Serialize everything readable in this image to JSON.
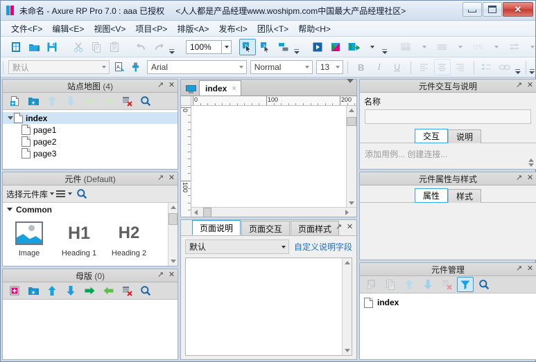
{
  "window": {
    "title": "未命名 - Axure RP Pro 7.0 : aaa 已授权",
    "subtitle": "<人人都是产品经理www.woshipm.com中国最大产品经理社区>",
    "logo_icon": "axure-logo-icon",
    "controls": {
      "minimize": "minimize-icon",
      "maximize": "maximize-icon",
      "close": "close-icon"
    }
  },
  "menu": {
    "items": [
      {
        "label": "文件<F>",
        "name": "menu-file"
      },
      {
        "label": "编辑<E>",
        "name": "menu-edit"
      },
      {
        "label": "视图<V>",
        "name": "menu-view"
      },
      {
        "label": "项目<P>",
        "name": "menu-project"
      },
      {
        "label": "排版<A>",
        "name": "menu-layout"
      },
      {
        "label": "发布<I>",
        "name": "menu-publish"
      },
      {
        "label": "团队<T>",
        "name": "menu-team"
      },
      {
        "label": "帮助<H>",
        "name": "menu-help"
      }
    ]
  },
  "toolbar": {
    "zoom_value": "100%",
    "buttons": [
      "new-file-icon",
      "open-folder-icon",
      "save-icon",
      "cut-icon",
      "copy-icon",
      "paste-icon",
      "undo-icon",
      "redo-icon",
      "select-mode-icon",
      "connect-mode-icon",
      "relative-mode-icon",
      "preview-icon",
      "generate-prototype-icon",
      "publish-icon"
    ]
  },
  "format_bar": {
    "style_value": "默认",
    "font_value": "Arial",
    "weight_value": "Normal",
    "size_value": "13",
    "bold": "B",
    "italic": "I",
    "underline": "U"
  },
  "sitemap": {
    "title": "站点地图",
    "count": "(4)",
    "toolbar": [
      "add-page-icon",
      "add-folder-icon",
      "move-up-icon",
      "move-down-icon",
      "indent-icon",
      "outdent-icon",
      "delete-page-icon",
      "search-icon"
    ],
    "tree": [
      {
        "label": "index",
        "level": 0,
        "selected": true,
        "expanded": true
      },
      {
        "label": "page1",
        "level": 1,
        "selected": false
      },
      {
        "label": "page2",
        "level": 1,
        "selected": false
      },
      {
        "label": "page3",
        "level": 1,
        "selected": false
      }
    ]
  },
  "widgets": {
    "title": "元件",
    "count": "(Default)",
    "library_label": "选择元件库",
    "group_label": "Common",
    "items": [
      {
        "caption": "Image",
        "icon": "image-widget-icon"
      },
      {
        "caption": "Heading 1",
        "glyph": "H1"
      },
      {
        "caption": "Heading 2",
        "glyph": "H2"
      }
    ]
  },
  "masters": {
    "title": "母版",
    "count": "(0)",
    "toolbar": [
      "add-master-icon",
      "add-folder-icon",
      "move-up-icon",
      "move-down-icon",
      "indent-icon",
      "outdent-icon",
      "delete-master-icon",
      "search-icon"
    ]
  },
  "canvas": {
    "tab_label": "index",
    "tab_close": "×",
    "tab_icon": "page-preview-icon",
    "ruler": {
      "h_labels": [
        "0",
        "100",
        "200"
      ],
      "v_labels": [
        "0",
        "100"
      ]
    }
  },
  "notes": {
    "tabs": [
      {
        "label": "页面说明",
        "active": true
      },
      {
        "label": "页面交互",
        "active": false
      },
      {
        "label": "页面样式",
        "active": false
      }
    ],
    "dropdown_value": "默认",
    "custom_fields_link": "自定义说明字段",
    "textarea_value": ""
  },
  "widget_notes": {
    "title": "元件交互与说明",
    "name_label": "名称",
    "name_value": "",
    "tabs": [
      {
        "label": "交互",
        "active": true
      },
      {
        "label": "说明",
        "active": false
      }
    ],
    "hint": "添加用例...  创建连接..."
  },
  "widget_props": {
    "title": "元件属性与样式",
    "tabs": [
      {
        "label": "属性",
        "active": true
      },
      {
        "label": "样式",
        "active": false
      }
    ]
  },
  "widget_manager": {
    "title": "元件管理",
    "toolbar": [
      "add-icon",
      "duplicate-icon",
      "move-up-icon",
      "move-down-icon",
      "delete-icon",
      "filter-icon",
      "search-icon"
    ],
    "items": [
      {
        "label": "index"
      }
    ]
  },
  "colors": {
    "accent": "#1b9dd9",
    "tab_active_border": "#39a5e0",
    "selection": "#cfe4f5",
    "link": "#1e6fc4",
    "close_red": "#c23b32"
  }
}
